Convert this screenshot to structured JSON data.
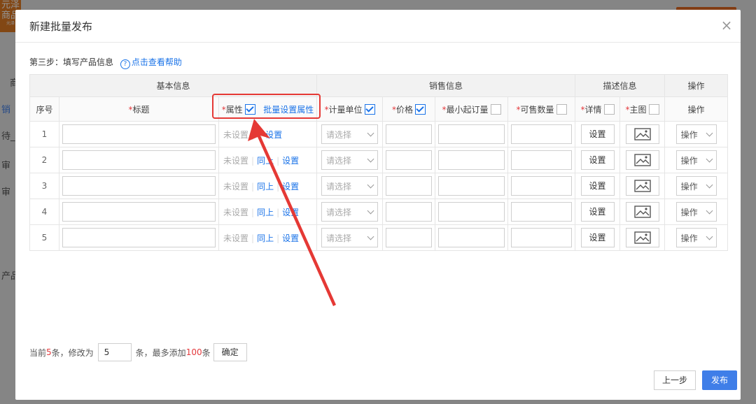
{
  "background": {
    "logo_line1": "元泽",
    "logo_line2": "商品",
    "logo_line3": "元泽",
    "sidebar": [
      "商",
      "销",
      "待_",
      "审",
      "审",
      "产品"
    ]
  },
  "modal": {
    "title": "新建批量发布",
    "step_label": "第三步：填写产品信息",
    "help_label": "点击查看帮助",
    "groups": {
      "basic": "基本信息",
      "sales": "销售信息",
      "desc": "描述信息",
      "ops": "操作"
    },
    "columns": {
      "index": "序号",
      "title": "标题",
      "attr": "属性",
      "batch_attr": "批量设置属性",
      "unit": "计量单位",
      "price": "价格",
      "min_order": "最小起订量",
      "stock": "可售数量",
      "detail": "详情",
      "main_image": "主图",
      "ops": "操作"
    },
    "rows": [
      {
        "index": "1",
        "attr_status": "未设置",
        "same_as_above": "",
        "set_label": "设置",
        "unit_placeholder": "请选择",
        "detail_button": "设置",
        "ops_label": "操作"
      },
      {
        "index": "2",
        "attr_status": "未设置",
        "same_as_above": "同上",
        "set_label": "设置",
        "unit_placeholder": "请选择",
        "detail_button": "设置",
        "ops_label": "操作"
      },
      {
        "index": "3",
        "attr_status": "未设置",
        "same_as_above": "同上",
        "set_label": "设置",
        "unit_placeholder": "请选择",
        "detail_button": "设置",
        "ops_label": "操作"
      },
      {
        "index": "4",
        "attr_status": "未设置",
        "same_as_above": "同上",
        "set_label": "设置",
        "unit_placeholder": "请选择",
        "detail_button": "设置",
        "ops_label": "操作"
      },
      {
        "index": "5",
        "attr_status": "未设置",
        "same_as_above": "同上",
        "set_label": "设置",
        "unit_placeholder": "请选择",
        "detail_button": "设置",
        "ops_label": "操作"
      }
    ],
    "footer": {
      "current_prefix": "当前",
      "current_count": "5",
      "current_suffix": "条，修改为",
      "count_value": "5",
      "max_prefix": "条，最多添加",
      "max_count": "100",
      "max_suffix": "条",
      "confirm": "确定"
    },
    "prev_button": "上一步",
    "publish_button": "发布"
  },
  "colors": {
    "accent": "#3f7ee8",
    "required": "#e4393c",
    "annotation": "#e53935"
  }
}
